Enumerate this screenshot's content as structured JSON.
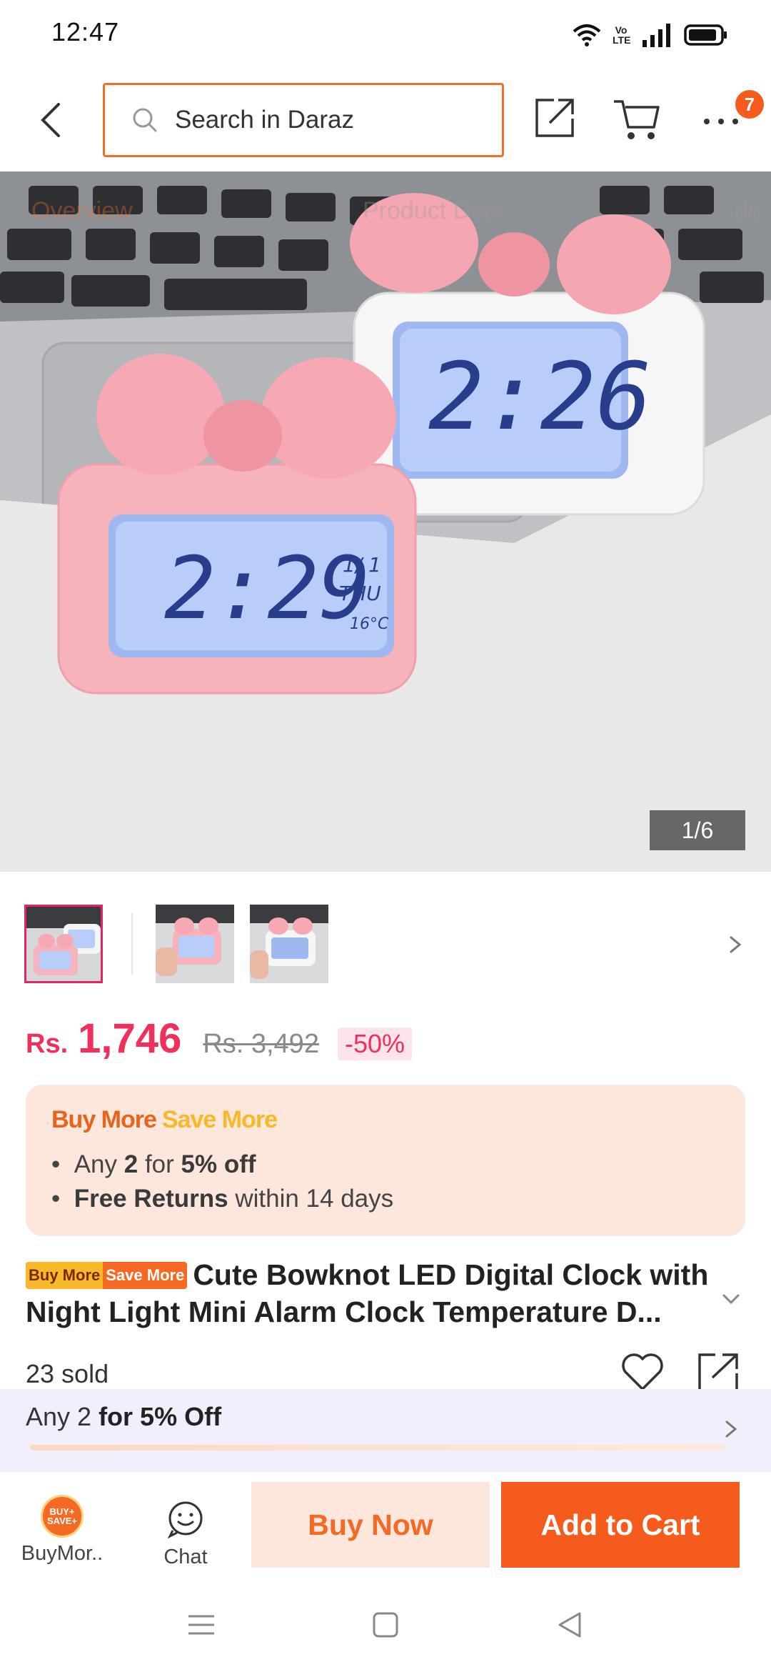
{
  "status_bar": {
    "time": "12:47",
    "icons": [
      "wifi-icon",
      "volte-icon",
      "signal-icon",
      "battery-icon"
    ],
    "volte_label": "Vo LTE"
  },
  "header": {
    "search_placeholder": "Search in Daraz",
    "cart_badge": "7",
    "accent_color": "#f36e24"
  },
  "hero": {
    "tabs": [
      "Overview",
      "Product Deta",
      "...do"
    ],
    "clock_front_time": "2:29",
    "clock_back_time": "2:26",
    "clock_date": "1/ 1",
    "clock_day": "THU",
    "clock_temp": "16°C",
    "counter": "1/6"
  },
  "thumbnails": [
    {
      "label": "2:26 / 2:29",
      "active": true
    },
    {
      "label": "2:30",
      "active": false
    },
    {
      "label": "2:27",
      "active": false
    }
  ],
  "price": {
    "currency": "Rs.",
    "value": "1,746",
    "original": "Rs. 3,492",
    "discount": "-50%",
    "color": "#f0305a"
  },
  "promo": {
    "title_buy": "Buy More",
    "title_save": "Save More",
    "line1_pre": "Any ",
    "line1_bold1": "2",
    "line1_mid": " for ",
    "line1_bold2": "5% off",
    "line2_bold": "Free Returns",
    "line2_rest": " within 14 days"
  },
  "product": {
    "tag_buy": "Buy More",
    "tag_save": "Save More",
    "title": "Cute Bowknot LED Digital Clock with Night Light Mini Alarm Clock Temperature D...",
    "sold": "23 sold"
  },
  "voucher": {
    "pre": "Any 2 ",
    "bold": "for 5% Off"
  },
  "actions": {
    "store_label": "BuyMor..",
    "store_icon_text": "BUY+ SAVE+",
    "chat_label": "Chat",
    "buy_now": "Buy Now",
    "add_to_cart": "Add to Cart",
    "primary_color": "#f45b1c"
  }
}
